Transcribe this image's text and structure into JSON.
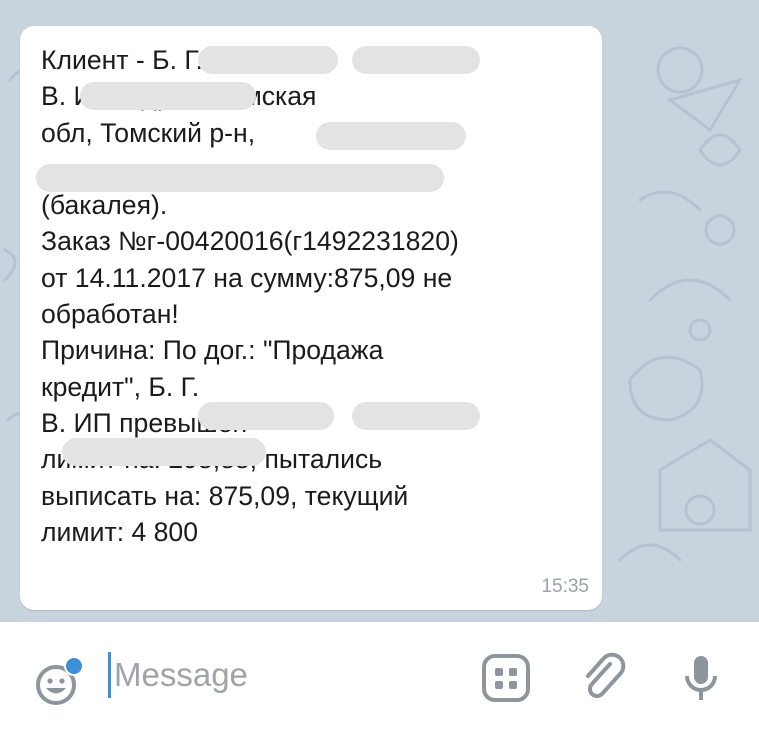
{
  "message": {
    "lines": [
      "Клиент - Б. Г.",
      "В. ИП, адрес: Томская",
      "обл, Томский р-н,",
      "",
      "(бакалея).",
      "Заказ №г-00420016(г1492231820)",
      "от 14.11.2017 на сумму:875,09 не",
      "обработан!",
      "Причина: По дог.: \"Продажа",
      "кредит\", Б. Г.",
      "В. ИП превышен",
      "лимит на: 298,88, пытались",
      "выписать на: 875,09, текущий",
      "лимит: 4 800"
    ],
    "time": "15:35"
  },
  "composer": {
    "placeholder": "Message"
  },
  "icons": {
    "emoji": "emoji-icon",
    "bot_commands": "bot-commands-icon",
    "attach": "paperclip-icon",
    "mic": "microphone-icon"
  },
  "colors": {
    "chat_background": "#c7d3dd",
    "bubble": "#ffffff",
    "accent": "#3d8fd6",
    "icon_gray": "#8e969d"
  }
}
